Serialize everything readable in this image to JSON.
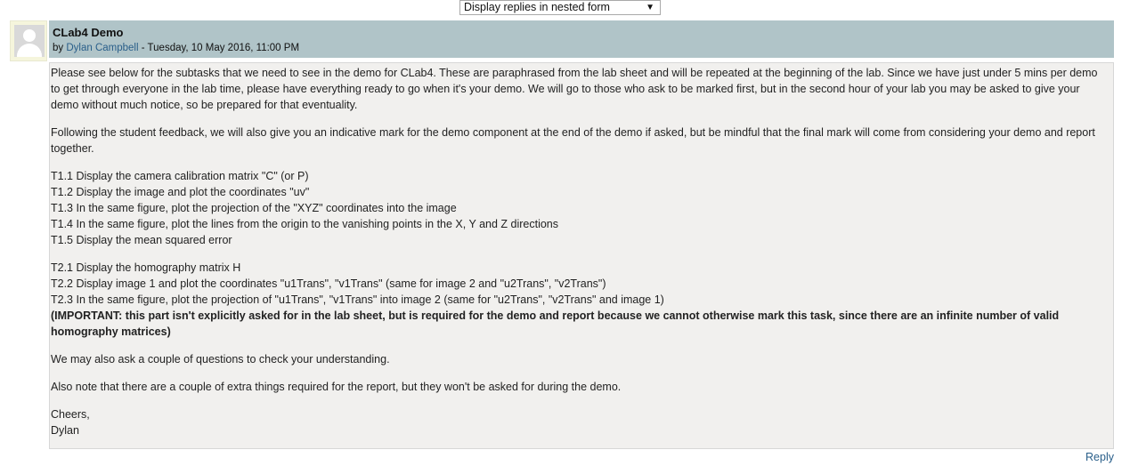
{
  "display_select": {
    "selected": "Display replies in nested form"
  },
  "post": {
    "title": "CLab4 Demo",
    "by_prefix": "by",
    "author": "Dylan Campbell",
    "date": " - Tuesday, 10 May 2016, 11:00 PM",
    "paragraph1": "Please see below for the subtasks that we need to see in the demo for CLab4. These are paraphrased from the lab sheet and will be repeated at the beginning of the lab. Since we have just under 5 mins per demo to get through everyone in the lab time, please have everything ready to go when it's your demo. We will go to those who ask to be marked first, but in the second hour of your lab you may be asked to give your demo without much notice, so be prepared for that eventuality.",
    "paragraph2": "Following the student feedback, we will also give you an indicative mark for the demo component at the end of the demo if asked, but be mindful that the final mark will come from considering your demo and report together.",
    "tasks1": [
      "T1.1 Display the camera calibration matrix \"C\" (or P)",
      "T1.2 Display the image and plot the coordinates \"uv\"",
      "T1.3 In the same figure, plot the projection of the \"XYZ\" coordinates into the image",
      "T1.4 In the same figure, plot the lines from the origin to the vanishing points in the X, Y and Z directions",
      "T1.5 Display the mean squared error"
    ],
    "tasks2": [
      "T2.1 Display the homography matrix H",
      "T2.2 Display image 1 and plot the coordinates \"u1Trans\", \"v1Trans\" (same for image 2 and \"u2Trans\", \"v2Trans\")",
      "T2.3 In the same figure, plot the projection of \"u1Trans\", \"v1Trans\" into image 2 (same for \"u2Trans\", \"v2Trans\" and image 1)"
    ],
    "important": "(IMPORTANT: this part isn't explicitly asked for in the lab sheet, but is required for the demo and report because we cannot otherwise mark this task, since there are an infinite number of valid homography matrices)",
    "paragraph3": "We may also ask a couple of questions to check your understanding.",
    "paragraph4": "Also note that there are a couple of extra things required for the report, but they won't be asked for during the demo.",
    "signoff1": "Cheers,",
    "signoff2": "Dylan",
    "reply_label": "Reply"
  },
  "icons": {
    "dropdown": "chevron-down-icon",
    "avatar": "user-avatar-icon"
  }
}
